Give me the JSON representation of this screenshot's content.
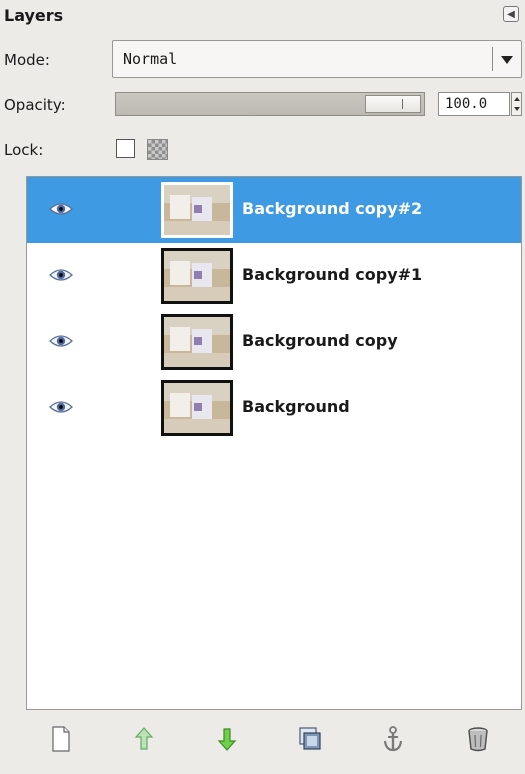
{
  "panel": {
    "title": "Layers",
    "menu_button_icon": "tab-menu-icon"
  },
  "mode": {
    "label": "Mode:",
    "value": "Normal"
  },
  "opacity": {
    "label": "Opacity:",
    "value": "100.0",
    "slider_fraction": 1.0
  },
  "lock": {
    "label": "Lock:",
    "pixels_locked": false,
    "alpha_locked_icon": "checkerboard-icon"
  },
  "layers": [
    {
      "name": "Background copy#2",
      "visible": true,
      "selected": true
    },
    {
      "name": "Background copy#1",
      "visible": true,
      "selected": false
    },
    {
      "name": "Background copy",
      "visible": true,
      "selected": false
    },
    {
      "name": "Background",
      "visible": true,
      "selected": false
    }
  ],
  "toolbar": [
    {
      "icon": "new-layer-icon"
    },
    {
      "icon": "raise-layer-icon"
    },
    {
      "icon": "lower-layer-icon"
    },
    {
      "icon": "duplicate-layer-icon"
    },
    {
      "icon": "anchor-layer-icon"
    },
    {
      "icon": "delete-layer-icon"
    }
  ],
  "colors": {
    "selected_row": "#3e9ae2",
    "panel_bg": "#ecebe8",
    "list_bg": "#ffffff"
  }
}
